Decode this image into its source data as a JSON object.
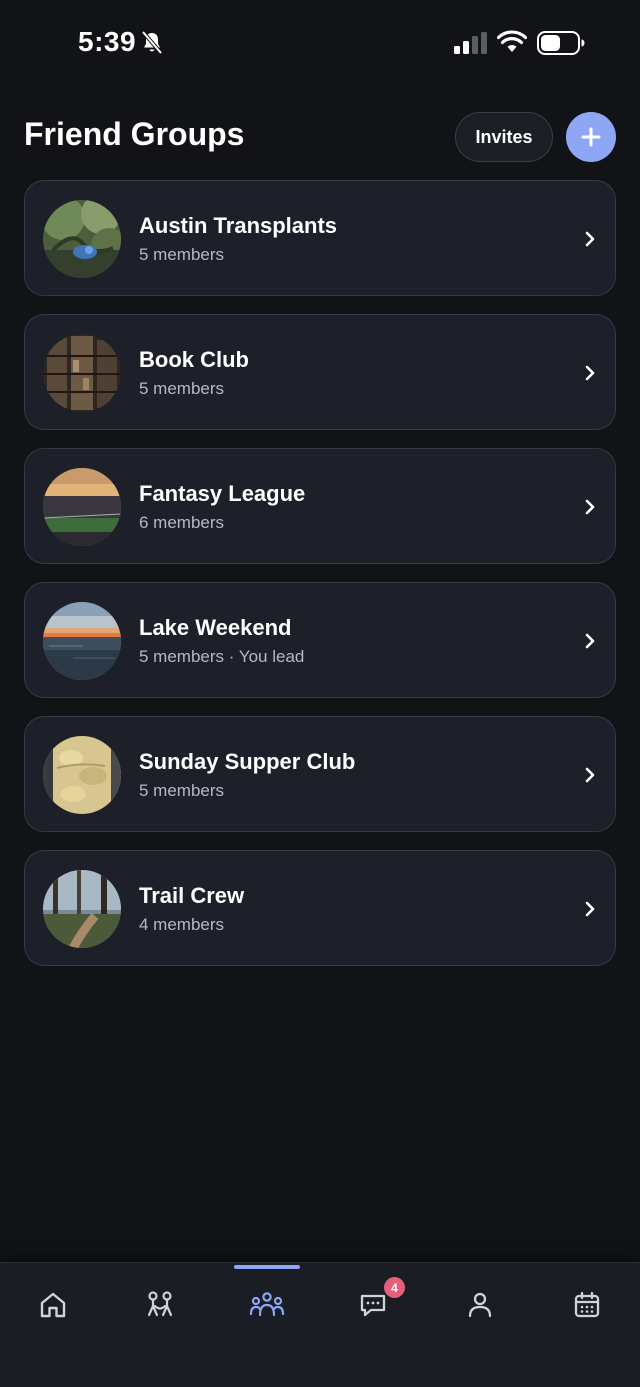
{
  "status_bar": {
    "time": "5:39",
    "icons": [
      "bell-off-icon",
      "cellular-signal-icon",
      "wifi-icon",
      "battery-icon"
    ]
  },
  "header": {
    "title": "Friend Groups",
    "invites_label": "Invites",
    "add_icon": "plus-icon"
  },
  "groups": [
    {
      "name": "Austin Transplants",
      "meta": "5 members"
    },
    {
      "name": "Book Club",
      "meta": "5 members"
    },
    {
      "name": "Fantasy League",
      "meta": "6 members"
    },
    {
      "name": "Lake Weekend",
      "meta": "5 members · You lead"
    },
    {
      "name": "Sunday Supper Club",
      "meta": "5 members"
    },
    {
      "name": "Trail Crew",
      "meta": "4 members"
    }
  ],
  "bottom_nav": {
    "items": [
      {
        "icon": "home-icon"
      },
      {
        "icon": "pair-people-icon"
      },
      {
        "icon": "groups-icon",
        "active": true
      },
      {
        "icon": "messages-icon",
        "badge": "4"
      },
      {
        "icon": "profile-icon"
      },
      {
        "icon": "calendar-icon"
      }
    ]
  },
  "colors": {
    "background": "#121317",
    "card": "#1d2029",
    "accent": "#8fa6f5",
    "badge": "#e4607a",
    "muted_text": "#b4b9c4"
  }
}
